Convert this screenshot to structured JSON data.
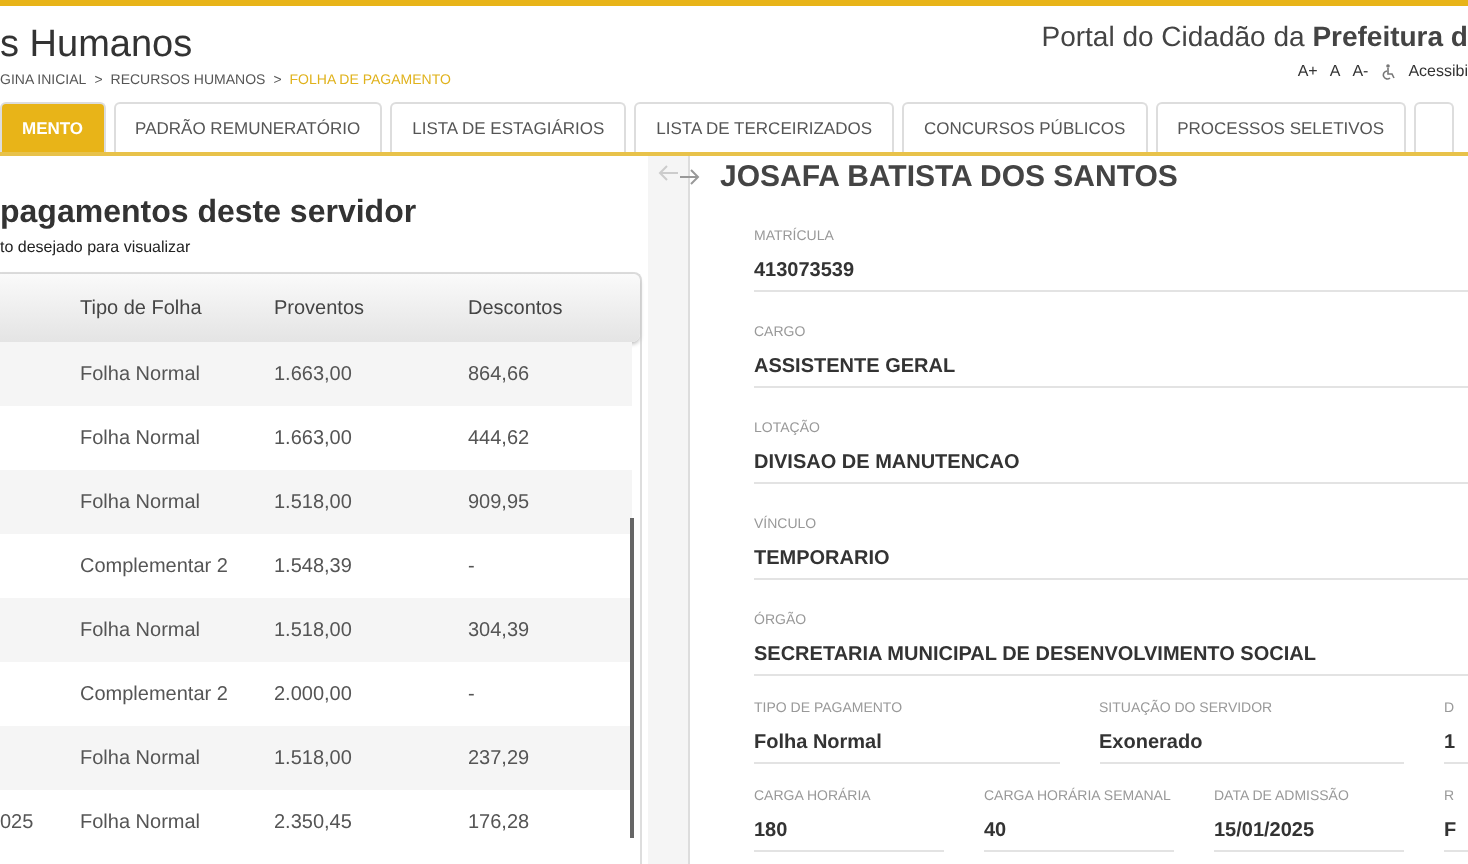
{
  "header": {
    "title": "s Humanos",
    "breadcrumb": [
      {
        "label": "GINA INICIAL",
        "current": false
      },
      {
        "label": "RECURSOS HUMANOS",
        "current": false
      },
      {
        "label": "FOLHA DE PAGAMENTO",
        "current": true
      }
    ],
    "separator": ">",
    "portal": "Portal do Cidadão da **Prefeitura d**",
    "font_controls": [
      "A+",
      "A",
      "A-"
    ],
    "accessibility": "Acessibi"
  },
  "tabs": [
    {
      "label": "MENTO",
      "selected": true
    },
    {
      "label": "PADRÃO REMUNERATÓRIO",
      "selected": false
    },
    {
      "label": "LISTA DE ESTAGIÁRIOS",
      "selected": false
    },
    {
      "label": "LISTA DE TERCEIRIZADOS",
      "selected": false
    },
    {
      "label": "CONCURSOS PÚBLICOS",
      "selected": false
    },
    {
      "label": "PROCESSOS SELETIVOS",
      "selected": false
    }
  ],
  "payments": {
    "title": "pagamentos deste servidor",
    "subtitle": "to desejado para visualizar",
    "columns": [
      "Tipo de Folha",
      "Proventos",
      "Descontos"
    ],
    "rows": [
      {
        "tipo": "Folha Normal",
        "proventos": "1.663,00",
        "descontos": "864,66"
      },
      {
        "tipo": "Folha Normal",
        "proventos": "1.663,00",
        "descontos": "444,62"
      },
      {
        "tipo": "Folha Normal",
        "proventos": "1.518,00",
        "descontos": "909,95"
      },
      {
        "tipo": "Complementar 2",
        "proventos": "1.548,39",
        "descontos": "-"
      },
      {
        "tipo": "Folha Normal",
        "proventos": "1.518,00",
        "descontos": "304,39"
      },
      {
        "tipo": "Complementar 2",
        "proventos": "2.000,00",
        "descontos": "-"
      },
      {
        "tipo": "Folha Normal",
        "proventos": "1.518,00",
        "descontos": "237,29"
      },
      {
        "column_1": "025",
        "tipo": "Folha Normal",
        "proventos": "2.350,45",
        "descontos": "176,28"
      }
    ]
  },
  "employee": {
    "name": "JOSAFA BATISTA DOS SANTOS",
    "fields": [
      {
        "label": "MATRÍCULA",
        "value": "413073539"
      },
      {
        "label": "CARGO",
        "value": "ASSISTENTE GERAL"
      },
      {
        "label": "LOTAÇÃO",
        "value": "DIVISAO DE MANUTENCAO"
      },
      {
        "label": "VÍNCULO",
        "value": "TEMPORARIO"
      },
      {
        "label": "ÓRGÃO",
        "value": "SECRETARIA MUNICIPAL DE DESENVOLVIMENTO SOCIAL"
      }
    ],
    "grid_rows": [
      [
        {
          "label": "TIPO DE PAGAMENTO",
          "value": "Folha Normal"
        },
        {
          "label": "SITUAÇÃO DO SERVIDOR",
          "value": "Exonerado"
        },
        {
          "label": "D",
          "value": "1"
        }
      ],
      [
        {
          "label": "CARGA HORÁRIA",
          "value": "180"
        },
        {
          "label": "CARGA HORÁRIA SEMANAL",
          "value": "40"
        },
        {
          "label": "DATA DE ADMISSÃO",
          "value": "15/01/2025"
        },
        {
          "label": "R",
          "value": "F"
        }
      ]
    ]
  }
}
